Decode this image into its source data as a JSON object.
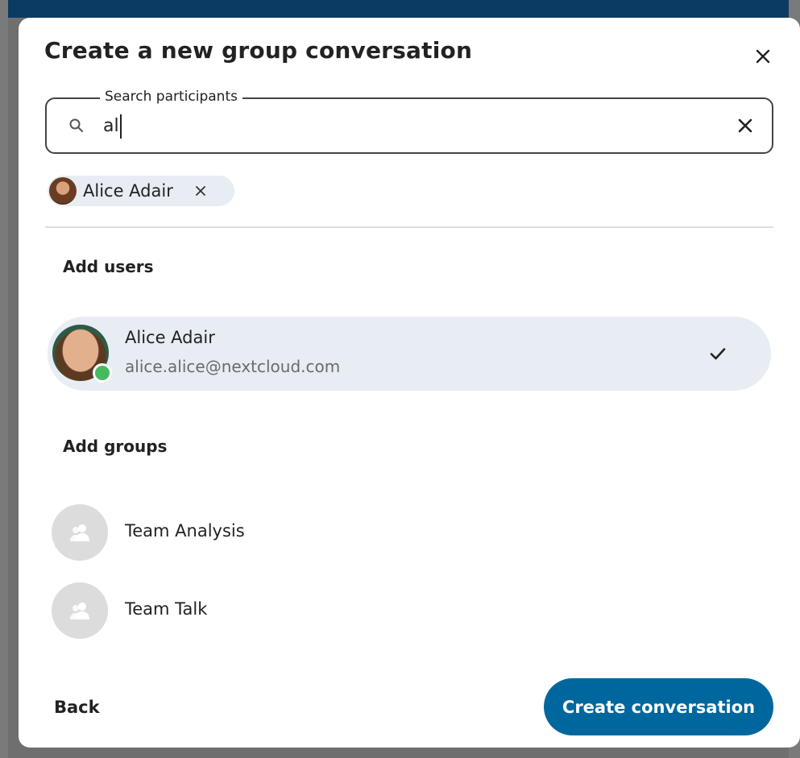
{
  "dialog": {
    "title": "Create a new group conversation",
    "close_icon": "close-icon"
  },
  "search": {
    "label": "Search participants",
    "value": "al",
    "icon": "search-icon",
    "clear_icon": "clear-icon"
  },
  "selected_chips": [
    {
      "label": "Alice Adair",
      "remove_icon": "close-icon"
    }
  ],
  "users_section": {
    "heading": "Add users",
    "items": [
      {
        "name": "Alice Adair",
        "email": "alice.alice@nextcloud.com",
        "selected": true,
        "status": "online"
      }
    ]
  },
  "groups_section": {
    "heading": "Add groups",
    "items": [
      {
        "name": "Team Analysis",
        "icon": "group-icon"
      },
      {
        "name": "Team Talk",
        "icon": "group-icon"
      }
    ]
  },
  "footer": {
    "back_label": "Back",
    "create_label": "Create conversation"
  },
  "colors": {
    "primary": "#00679e",
    "selected_bg": "#e7edf3",
    "online": "#46ba61",
    "topbar": "#0b3b63"
  }
}
